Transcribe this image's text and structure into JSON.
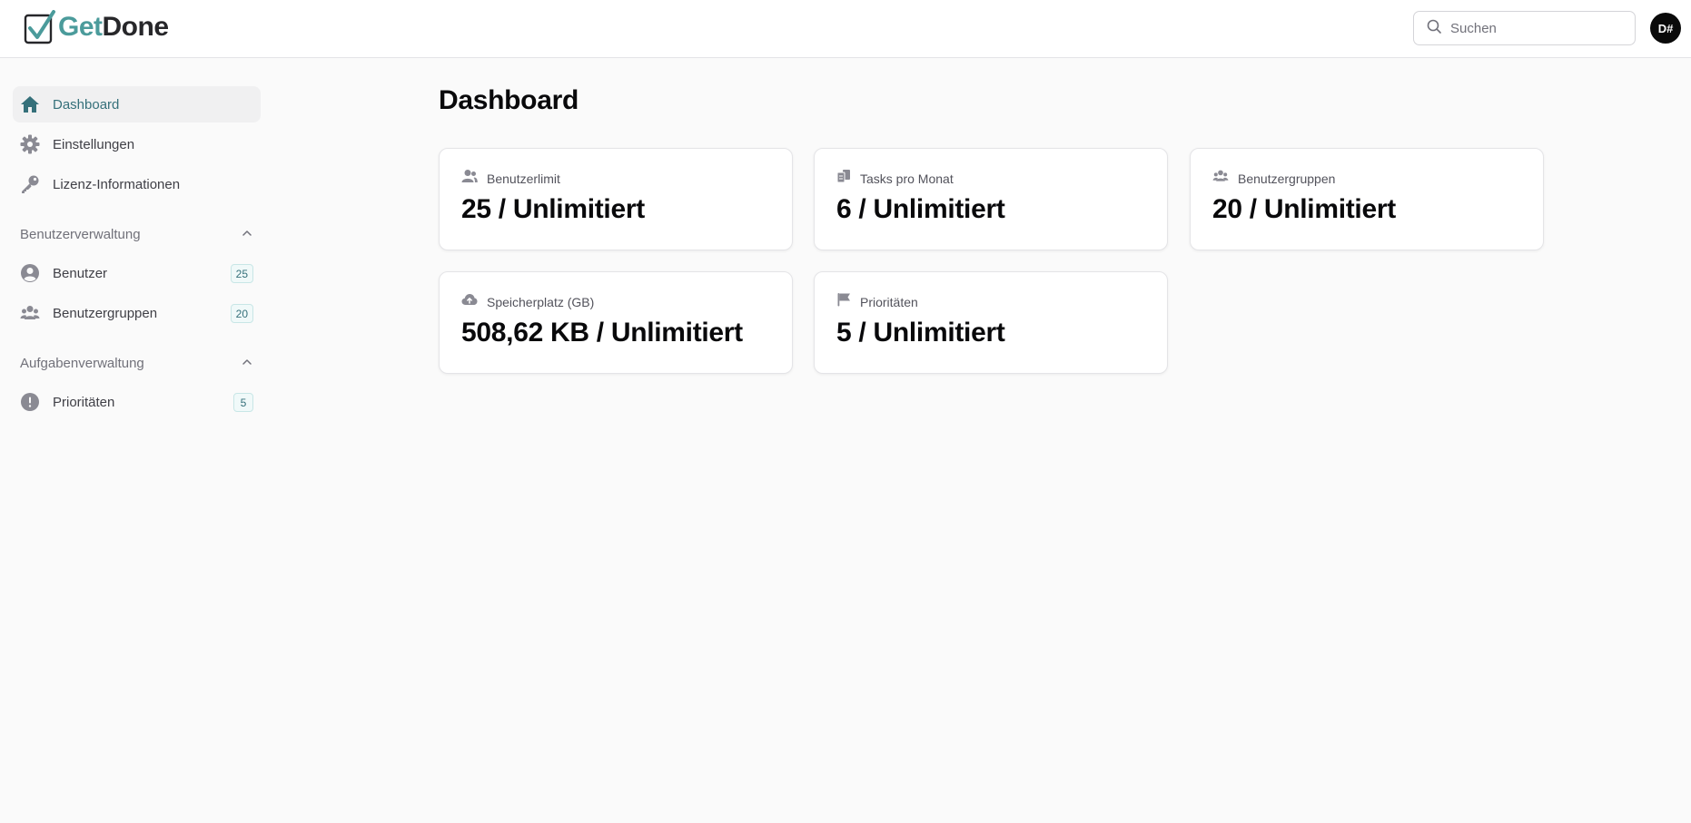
{
  "app": {
    "logo_get": "Get",
    "logo_done": "Done",
    "brand_color": "#4b9b9b"
  },
  "header": {
    "search_placeholder": "Suchen",
    "avatar_initials": "D#"
  },
  "sidebar": {
    "items": [
      {
        "label": "Dashboard",
        "icon": "home-icon",
        "active": true
      },
      {
        "label": "Einstellungen",
        "icon": "gear-icon"
      },
      {
        "label": "Lizenz-Informationen",
        "icon": "key-icon"
      }
    ],
    "sections": [
      {
        "title": "Benutzerverwaltung",
        "expanded": true,
        "items": [
          {
            "label": "Benutzer",
            "icon": "user-circle-icon",
            "count": "25"
          },
          {
            "label": "Benutzergruppen",
            "icon": "users-icon",
            "count": "20"
          }
        ]
      },
      {
        "title": "Aufgabenverwaltung",
        "expanded": true,
        "items": [
          {
            "label": "Prioritäten",
            "icon": "exclamation-circle-icon",
            "count": "5"
          }
        ]
      }
    ]
  },
  "main": {
    "title": "Dashboard",
    "cards": [
      {
        "label": "Benutzerlimit",
        "icon": "user-group-icon",
        "value": "25 / Unlimitiert"
      },
      {
        "label": "Tasks pro Monat",
        "icon": "tasks-icon",
        "value": "6 / Unlimitiert"
      },
      {
        "label": "Benutzergruppen",
        "icon": "users-icon",
        "value": "20 / Unlimitiert"
      },
      {
        "label": "Speicherplatz (GB)",
        "icon": "cloud-upload-icon",
        "value": "508,62 KB / Unlimitiert"
      },
      {
        "label": "Prioritäten",
        "icon": "flag-icon",
        "value": "5 / Unlimitiert"
      }
    ]
  }
}
